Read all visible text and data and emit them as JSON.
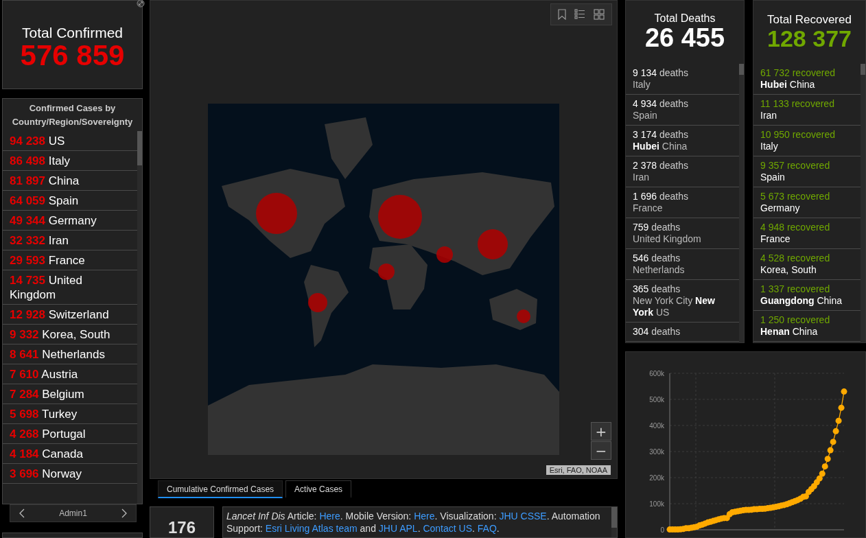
{
  "total_confirmed": {
    "title": "Total Confirmed",
    "value": "576 859"
  },
  "confirmed_list": {
    "title": "Confirmed Cases by Country/Region/Sovereignty",
    "rows": [
      {
        "count": "94 238",
        "place": "US"
      },
      {
        "count": "86 498",
        "place": "Italy"
      },
      {
        "count": "81 897",
        "place": "China"
      },
      {
        "count": "64 059",
        "place": "Spain"
      },
      {
        "count": "49 344",
        "place": "Germany"
      },
      {
        "count": "32 332",
        "place": "Iran"
      },
      {
        "count": "29 593",
        "place": "France"
      },
      {
        "count": "14 735",
        "place": "United Kingdom"
      },
      {
        "count": "12 928",
        "place": "Switzerland"
      },
      {
        "count": "9 332",
        "place": "Korea, South"
      },
      {
        "count": "8 641",
        "place": "Netherlands"
      },
      {
        "count": "7 610",
        "place": "Austria"
      },
      {
        "count": "7 284",
        "place": "Belgium"
      },
      {
        "count": "5 698",
        "place": "Turkey"
      },
      {
        "count": "4 268",
        "place": "Portugal"
      },
      {
        "count": "4 184",
        "place": "Canada"
      },
      {
        "count": "3 696",
        "place": "Norway"
      }
    ]
  },
  "list_nav": {
    "label": "Admin1"
  },
  "map": {
    "attribution": "Esri, FAO, NOAA",
    "zoom_in": "+",
    "zoom_out": "−"
  },
  "map_tabs": [
    {
      "label": "Cumulative Confirmed Cases",
      "selected": true
    },
    {
      "label": "Active Cases",
      "selected": false
    }
  ],
  "bottom_count": "176",
  "info": [
    {
      "kind": "italic",
      "text": "Lancet Inf Dis"
    },
    {
      "kind": "plain",
      "text": " Article: "
    },
    {
      "kind": "link",
      "text": "Here"
    },
    {
      "kind": "plain",
      "text": ". Mobile Version: "
    },
    {
      "kind": "link",
      "text": "Here"
    },
    {
      "kind": "plain",
      "text": ". Visualization: "
    },
    {
      "kind": "link",
      "text": "JHU CSSE"
    },
    {
      "kind": "plain",
      "text": ". Automation Support: "
    },
    {
      "kind": "link",
      "text": "Esri Living Atlas team"
    },
    {
      "kind": "plain",
      "text": " and "
    },
    {
      "kind": "link",
      "text": "JHU APL"
    },
    {
      "kind": "plain",
      "text": ". "
    },
    {
      "kind": "link",
      "text": "Contact US"
    },
    {
      "kind": "plain",
      "text": ". "
    },
    {
      "kind": "link",
      "text": "FAQ"
    },
    {
      "kind": "plain",
      "text": "."
    }
  ],
  "deaths": {
    "title": "Total Deaths",
    "value": "26 455",
    "rows": [
      {
        "count": "9 134",
        "unit": "deaths",
        "place": "Italy"
      },
      {
        "count": "4 934",
        "unit": "deaths",
        "place": "Spain"
      },
      {
        "count": "3 174",
        "unit": "deaths",
        "place": "**Hubei** China"
      },
      {
        "count": "2 378",
        "unit": "deaths",
        "place": "Iran"
      },
      {
        "count": "1 696",
        "unit": "deaths",
        "place": "France"
      },
      {
        "count": "759",
        "unit": "deaths",
        "place": "United Kingdom"
      },
      {
        "count": "546",
        "unit": "deaths",
        "place": "Netherlands"
      },
      {
        "count": "365",
        "unit": "deaths",
        "place": "New York City **New York** US"
      },
      {
        "count": "304",
        "unit": "deaths"
      }
    ]
  },
  "recovered": {
    "title": "Total Recovered",
    "value": "128 377",
    "rows": [
      {
        "count": "61 732",
        "unit": "recovered",
        "place": "**Hubei** China"
      },
      {
        "count": "11 133",
        "unit": "recovered",
        "place": "Iran"
      },
      {
        "count": "10 950",
        "unit": "recovered",
        "place": "Italy"
      },
      {
        "count": "9 357",
        "unit": "recovered",
        "place": "Spain"
      },
      {
        "count": "5 673",
        "unit": "recovered",
        "place": "Germany"
      },
      {
        "count": "4 948",
        "unit": "recovered",
        "place": "France"
      },
      {
        "count": "4 528",
        "unit": "recovered",
        "place": "Korea, South"
      },
      {
        "count": "1 337",
        "unit": "recovered",
        "place": "**Guangdong** China"
      },
      {
        "count": "1 250",
        "unit": "recovered",
        "place": "**Henan** China"
      }
    ]
  },
  "chart": {
    "chart_data": {
      "type": "line",
      "ylim": [
        0,
        600000
      ],
      "yticks": [
        {
          "value": 0,
          "label": "0"
        },
        {
          "value": 100000,
          "label": "100k"
        },
        {
          "value": 200000,
          "label": "200k"
        },
        {
          "value": 300000,
          "label": "300k"
        },
        {
          "value": 400000,
          "label": "400k"
        },
        {
          "value": 500000,
          "label": "500k"
        },
        {
          "value": 600000,
          "label": "600k"
        }
      ],
      "grid": true,
      "series": [
        {
          "color": "#ffaa00",
          "marker": true,
          "values": [
            1000,
            1000,
            1000,
            1000,
            2000,
            3000,
            6000,
            6000,
            8000,
            10000,
            12000,
            17000,
            20000,
            24000,
            28000,
            31000,
            34000,
            37000,
            40000,
            43000,
            45000,
            45000,
            60000,
            67000,
            69000,
            71000,
            73000,
            75000,
            76000,
            76000,
            77000,
            79000,
            79000,
            80000,
            80000,
            81000,
            83000,
            84000,
            86000,
            88000,
            90000,
            93000,
            95000,
            98000,
            102000,
            106000,
            110000,
            114000,
            119000,
            126000,
            128000,
            145000,
            156000,
            167000,
            182000,
            197000,
            215000,
            243000,
            272000,
            305000,
            337000,
            378000,
            418000,
            468000,
            530000
          ]
        }
      ]
    }
  }
}
